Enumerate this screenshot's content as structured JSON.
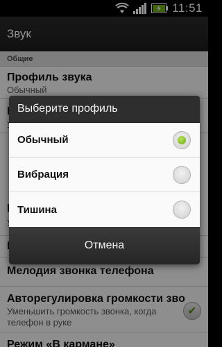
{
  "status_bar": {
    "time": "11:51"
  },
  "header": {
    "title": "Звук"
  },
  "settings": {
    "section_general": "Общие",
    "profile_title": "Профиль звука",
    "profile_value": "Обычный",
    "partial_1": "П",
    "partial_1_sub": "У",
    "partial_2": "Б",
    "partial_2_sub": "У",
    "partial_3": "В",
    "ringtone_title": "Мелодия звонка телефона",
    "autovol_title": "Авторегулировка громкости зво",
    "autovol_sub": "Уменьшить громкость звонка, когда телефон в руке",
    "pocket_title": "Режим «В кармане»"
  },
  "dialog": {
    "title": "Выберите профиль",
    "options": [
      {
        "label": "Обычный",
        "selected": true
      },
      {
        "label": "Вибрация",
        "selected": false
      },
      {
        "label": "Тишина",
        "selected": false
      }
    ],
    "cancel_label": "Отмена"
  },
  "colors": {
    "accent_green": "#6cab12"
  }
}
